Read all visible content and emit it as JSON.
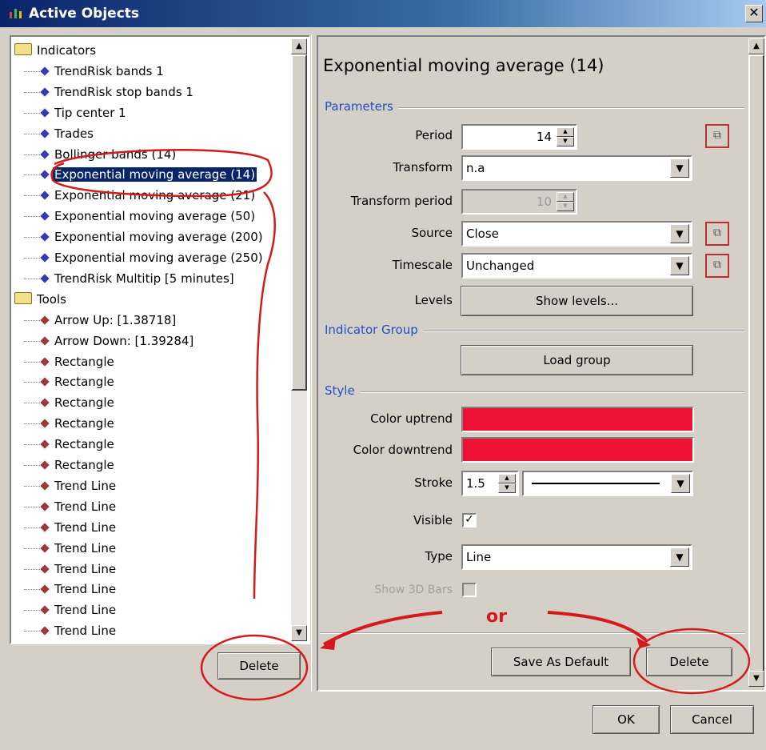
{
  "window": {
    "title": "Active Objects",
    "close_glyph": "✕"
  },
  "tree": {
    "groups": [
      {
        "label": "Indicators",
        "icon": "folder-icon"
      },
      {
        "label": "Tools",
        "icon": "folder-icon"
      }
    ],
    "indicators": [
      "TrendRisk bands 1",
      "TrendRisk stop bands 1",
      "Tip center 1",
      "Trades",
      "Bollinger bands (14)",
      "Exponential moving average (14)",
      "Exponential moving average (21)",
      "Exponential moving average (50)",
      "Exponential moving average (200)",
      "Exponential moving average (250)",
      "TrendRisk Multitip [5 minutes]"
    ],
    "tools": [
      "Arrow Up: [1.38718]",
      "Arrow Down: [1.39284]",
      "Rectangle",
      "Rectangle",
      "Rectangle",
      "Rectangle",
      "Rectangle",
      "Rectangle",
      "Trend Line",
      "Trend Line",
      "Trend Line",
      "Trend Line",
      "Trend Line",
      "Trend Line",
      "Trend Line",
      "Trend Line"
    ],
    "selected": "Exponential moving average (14)",
    "delete_label": "Delete"
  },
  "panel": {
    "title": "Exponential moving average (14)",
    "sections": {
      "parameters": "Parameters",
      "group": "Indicator Group",
      "style": "Style"
    },
    "period": {
      "label": "Period",
      "value": "14"
    },
    "transform": {
      "label": "Transform",
      "value": "n.a"
    },
    "transform_period": {
      "label": "Transform period",
      "value": "10"
    },
    "source": {
      "label": "Source",
      "value": "Close"
    },
    "timescale": {
      "label": "Timescale",
      "value": "Unchanged"
    },
    "levels": {
      "label": "Levels",
      "button": "Show levels..."
    },
    "load_group": "Load group",
    "color_up": {
      "label": "Color uptrend",
      "color": "#ee1133"
    },
    "color_down": {
      "label": "Color downtrend",
      "color": "#ee1133"
    },
    "stroke": {
      "label": "Stroke",
      "value": "1.5"
    },
    "visible": {
      "label": "Visible",
      "checked": true
    },
    "type": {
      "label": "Type",
      "value": "Line"
    },
    "show3d": {
      "label": "Show 3D Bars",
      "checked": false
    },
    "save_default": "Save As Default",
    "delete_label": "Delete"
  },
  "annotation": {
    "or_text": "or"
  },
  "footer": {
    "ok": "OK",
    "cancel": "Cancel"
  }
}
